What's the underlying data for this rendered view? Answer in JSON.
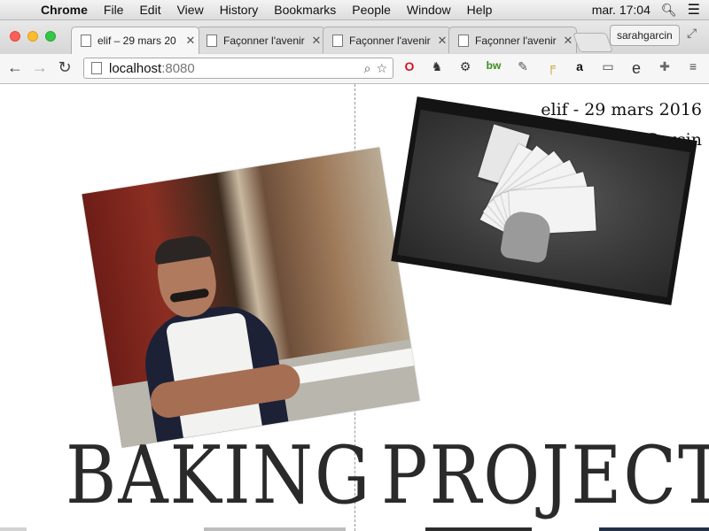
{
  "menubar": {
    "app": "Chrome",
    "items": [
      "File",
      "Edit",
      "View",
      "History",
      "Bookmarks",
      "People",
      "Window",
      "Help"
    ],
    "clock": "mar. 17:04"
  },
  "tabs": [
    {
      "title": "elif – 29 mars 20",
      "active": true
    },
    {
      "title": "Façonner l'avenir",
      "active": false
    },
    {
      "title": "Façonner l'avenir",
      "active": false
    },
    {
      "title": "Façonner l'avenir",
      "active": false
    }
  ],
  "profile": "sarahgarcin",
  "omnibox": {
    "host": "localhost",
    "port": ":8080"
  },
  "page": {
    "heading_line1": "elif - 29 mars 2016",
    "heading_line2": "Elif & Sarah Garcin",
    "word_left": "BAKING",
    "word_right": "PROJECTS"
  },
  "colors": {
    "menubar_bg": "#dcdcdc",
    "page_bg": "#ffffff",
    "text": "#2a2a2a"
  },
  "icons": {
    "apple": "apple-logo-icon",
    "back": "back-arrow-icon",
    "forward": "forward-arrow-icon",
    "reload": "reload-icon",
    "bookmark": "star-icon",
    "extensions": [
      "opera-icon",
      "evernote-icon",
      "gear-icon",
      "bw-icon",
      "eyedropper-icon",
      "ruler-icon",
      "amazon-icon",
      "cast-icon",
      "e-icon",
      "puzzle-icon"
    ],
    "menu": "hamburger-icon"
  }
}
